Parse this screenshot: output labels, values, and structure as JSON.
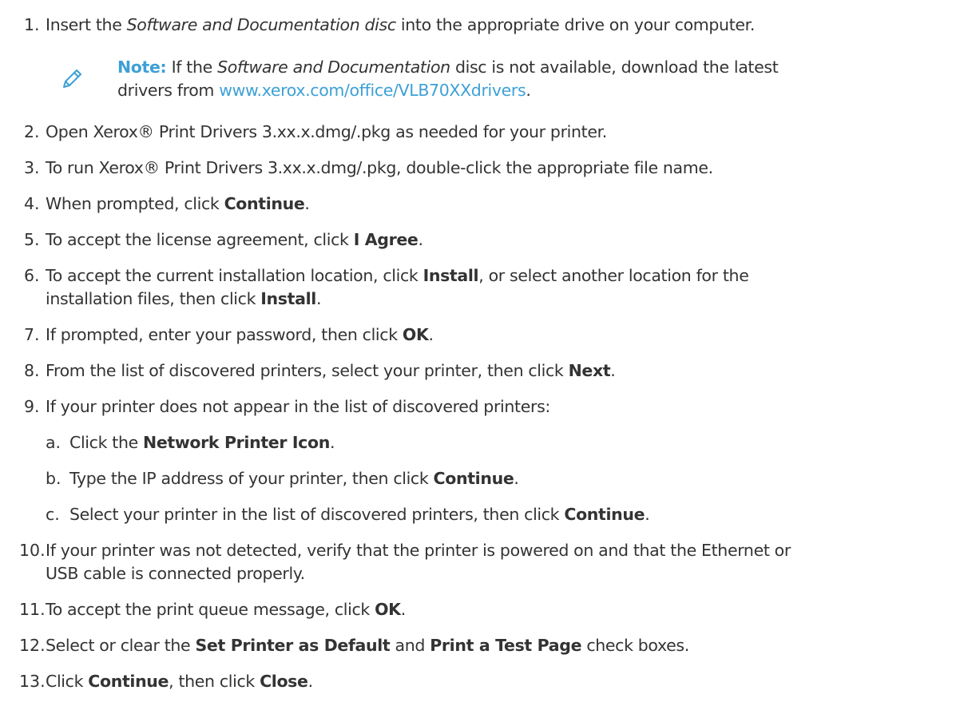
{
  "steps": [
    {
      "num": "1.",
      "pre": "Insert the ",
      "em": "Software and Documentation disc",
      "post": " into the appropriate drive on your computer."
    },
    {
      "num": "2.",
      "text": "Open Xerox® Print Drivers 3.xx.x.dmg/.pkg as needed for your printer."
    },
    {
      "num": "3.",
      "text": "To run Xerox® Print Drivers 3.xx.x.dmg/.pkg, double-click the appropriate file name."
    },
    {
      "num": "4.",
      "pre": "When prompted, click ",
      "b": "Continue",
      "post": "."
    },
    {
      "num": "5.",
      "pre": "To accept the license agreement, click ",
      "b": "I Agree",
      "post": "."
    },
    {
      "num": "6.",
      "pre": "To accept the current installation location, click ",
      "b": "Install",
      "post": ", or select another location for the",
      "line2_pre": "installation files, then click ",
      "line2_b": "Install",
      "line2_post": "."
    },
    {
      "num": "7.",
      "pre": "If prompted, enter your password, then click ",
      "b": "OK",
      "post": "."
    },
    {
      "num": "8.",
      "pre": "From the list of discovered printers, select your printer, then click ",
      "b": "Next",
      "post": "."
    },
    {
      "num": "9.",
      "text": "If your printer does not appear in the list of discovered printers:"
    },
    {
      "num": "10.",
      "text": "If your printer was not detected, verify that the printer is powered on and that the Ethernet or",
      "line2": "USB cable is connected properly."
    },
    {
      "num": "11.",
      "pre": "To accept the print queue message, click ",
      "b": "OK",
      "post": "."
    },
    {
      "num": "12.",
      "pre": "Select or clear the ",
      "b": "Set Printer as Default",
      "mid": " and ",
      "b2": "Print a Test Page",
      "post": " check boxes."
    },
    {
      "num": "13.",
      "pre": "Click ",
      "b": "Continue",
      "mid": ", then click ",
      "b2": "Close",
      "post": "."
    }
  ],
  "substeps": [
    {
      "letter": "a.",
      "pre": "Click the ",
      "b": "Network Printer Icon",
      "post": "."
    },
    {
      "letter": "b.",
      "pre": "Type the IP address of your printer, then click ",
      "b": "Continue",
      "post": "."
    },
    {
      "letter": "c.",
      "pre": "Select your printer in the list of discovered printers, then click ",
      "b": "Continue",
      "post": "."
    }
  ],
  "note": {
    "label": "Note:",
    "pre": " If the ",
    "em": "Software and Documentation",
    "post": " disc is not available, download the latest",
    "line2": "drivers from ",
    "link": "www.xerox.com/office/VLB70XXdrivers",
    "line2_end": ".",
    "icon": "pencil-icon",
    "accent": "#3da0d6"
  }
}
